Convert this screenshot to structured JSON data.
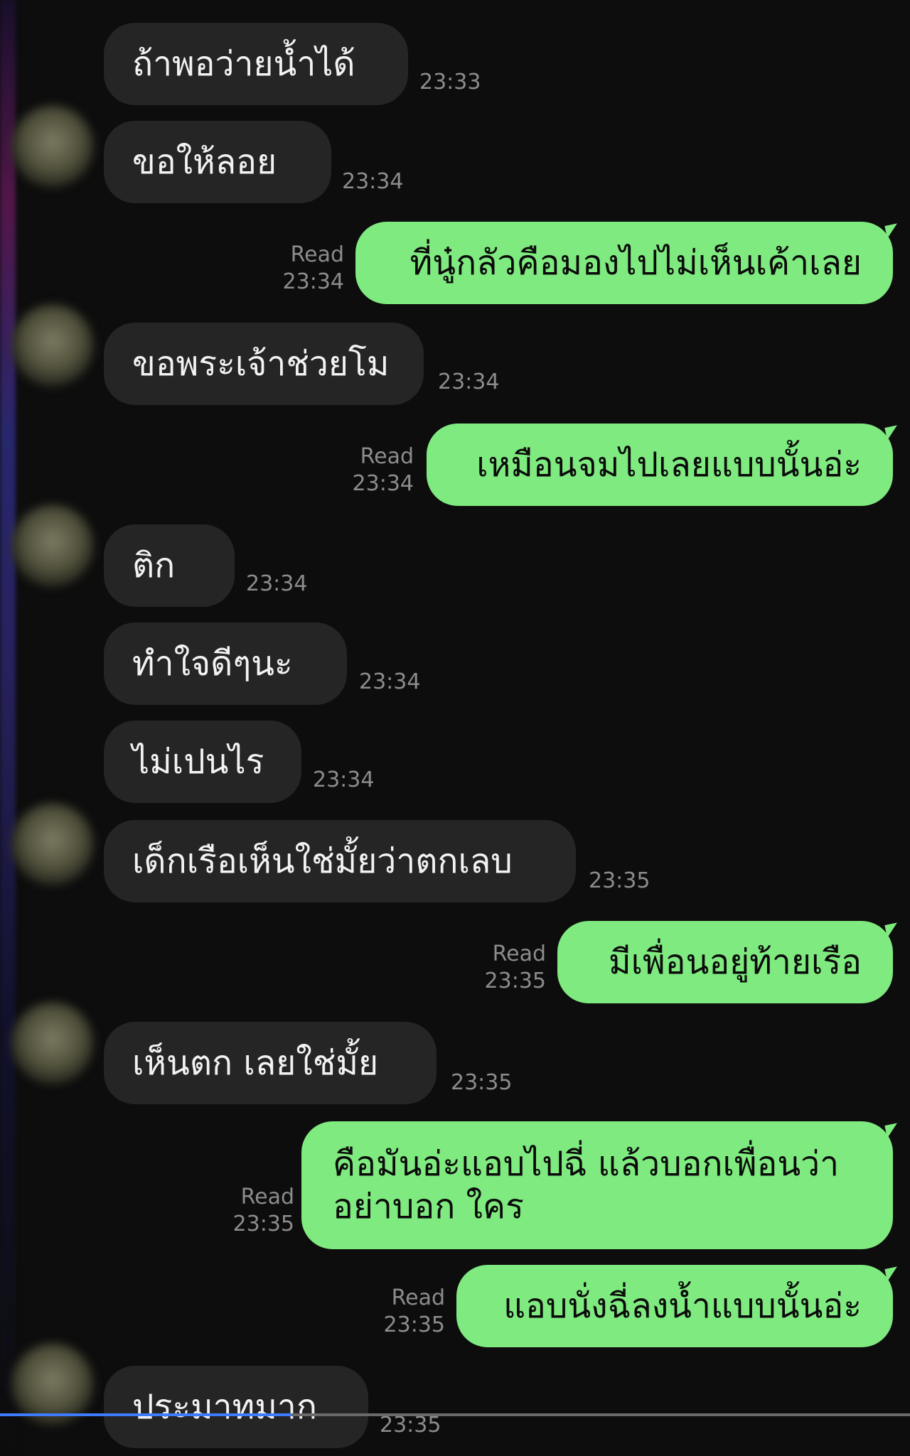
{
  "messages": [
    {
      "side": "in",
      "text": "ถ้าพอว่ายน้ำได้",
      "time": "23:33"
    },
    {
      "side": "in",
      "text": "ขอให้ลอย",
      "time": "23:34"
    },
    {
      "side": "out",
      "text": "ที่นู๋กลัวคือมองไปไม่เห็นเค้าเลย",
      "status": "Read",
      "time": "23:34"
    },
    {
      "side": "in",
      "text": "ขอพระเจ้าช่วยโม",
      "time": "23:34"
    },
    {
      "side": "out",
      "text": "เหมือนจมไปเลยแบบนั้นอ่ะ",
      "status": "Read",
      "time": "23:34"
    },
    {
      "side": "in",
      "text": "ติก",
      "time": "23:34"
    },
    {
      "side": "in",
      "text": "ทำใจดีๆนะ",
      "time": "23:34"
    },
    {
      "side": "in",
      "text": "ไม่เปนไร",
      "time": "23:34"
    },
    {
      "side": "in",
      "text": "เด็กเรือเห็นใช่มั้ยว่าตกเลบ",
      "time": "23:35"
    },
    {
      "side": "out",
      "text": "มีเพื่อนอยู่ท้ายเรือ",
      "status": "Read",
      "time": "23:35"
    },
    {
      "side": "in",
      "text": "เห็นตก เลยใช่มั้ย",
      "time": "23:35"
    },
    {
      "side": "out",
      "lines": [
        "คือมันอ่ะแอบไปฉี่ แล้วบอกเพื่อนว่า",
        "อย่าบอก ใคร"
      ],
      "status": "Read",
      "time": "23:35"
    },
    {
      "side": "out",
      "text": "แอบนั่งฉี่ลงน้ำแบบนั้นอ่ะ",
      "status": "Read",
      "time": "23:35"
    },
    {
      "side": "in",
      "text": "ประมาทมาก",
      "time": "23:35"
    }
  ],
  "video_progress": 0.32,
  "colors": {
    "background": "#0d0d0d",
    "incoming_bubble": "#252525",
    "outgoing_bubble": "#7fea7f",
    "timestamp": "#8c8c8c",
    "progress": "#3d7bff"
  },
  "icons": [
    "avatar-icon"
  ]
}
